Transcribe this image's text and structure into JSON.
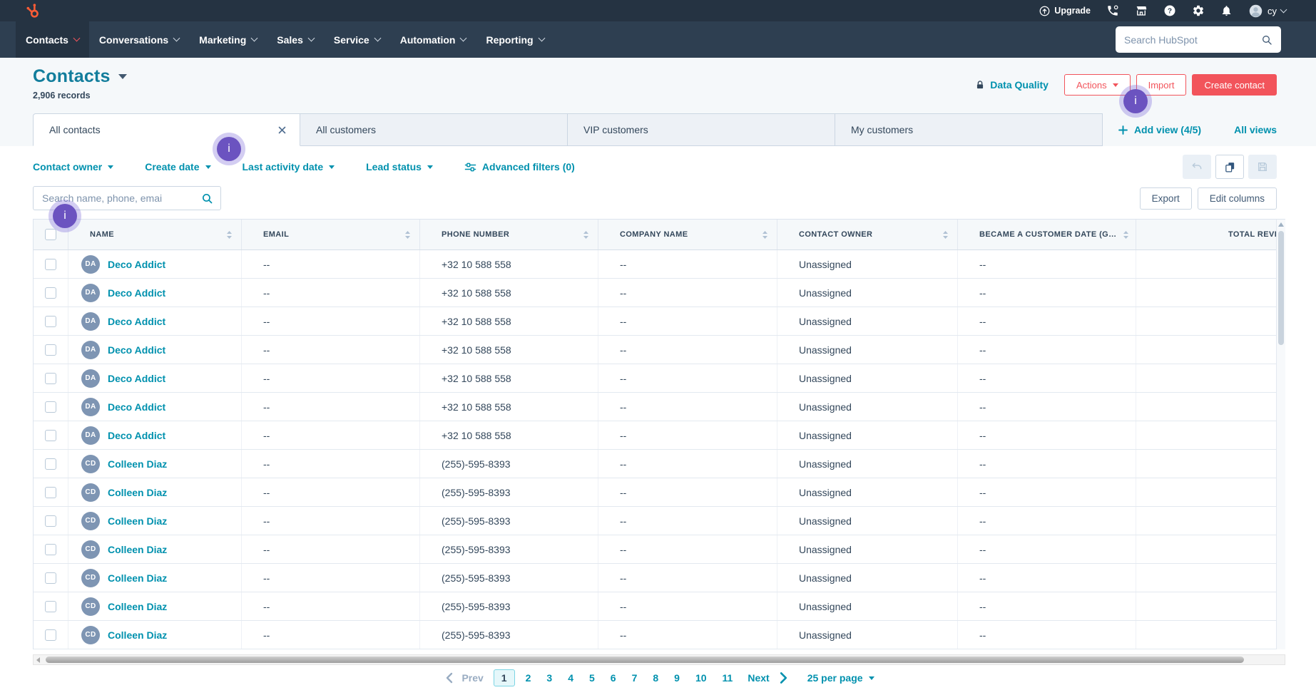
{
  "nav": {
    "items": [
      "Contacts",
      "Conversations",
      "Marketing",
      "Sales",
      "Service",
      "Automation",
      "Reporting"
    ],
    "active_item": "Contacts",
    "upgrade_label": "Upgrade",
    "user_name": "cy",
    "search_placeholder": "Search HubSpot"
  },
  "header": {
    "title": "Contacts",
    "records": "2,906 records",
    "data_quality_label": "Data Quality",
    "actions_label": "Actions",
    "import_label": "Import",
    "create_contact_label": "Create contact"
  },
  "tabs": {
    "items": [
      "All contacts",
      "All customers",
      "VIP customers",
      "My customers"
    ],
    "active_tab": "All contacts",
    "add_view_label": "Add view (4/5)",
    "all_views_label": "All views"
  },
  "filters": {
    "items": [
      "Contact owner",
      "Create date",
      "Last activity date",
      "Lead status"
    ],
    "advanced_label": "Advanced filters (0)"
  },
  "toolbar": {
    "search_placeholder": "Search name, phone, emai",
    "export_label": "Export",
    "edit_columns_label": "Edit columns"
  },
  "table": {
    "columns": [
      "NAME",
      "EMAIL",
      "PHONE NUMBER",
      "COMPANY NAME",
      "CONTACT OWNER",
      "BECAME A CUSTOMER DATE (G…",
      "TOTAL REVE"
    ],
    "rows": [
      {
        "initials": "DA",
        "name": "Deco Addict",
        "email": "--",
        "phone": "+32 10 588 558",
        "company": "--",
        "owner": "Unassigned",
        "became": "--",
        "total": ""
      },
      {
        "initials": "DA",
        "name": "Deco Addict",
        "email": "--",
        "phone": "+32 10 588 558",
        "company": "--",
        "owner": "Unassigned",
        "became": "--",
        "total": ""
      },
      {
        "initials": "DA",
        "name": "Deco Addict",
        "email": "--",
        "phone": "+32 10 588 558",
        "company": "--",
        "owner": "Unassigned",
        "became": "--",
        "total": ""
      },
      {
        "initials": "DA",
        "name": "Deco Addict",
        "email": "--",
        "phone": "+32 10 588 558",
        "company": "--",
        "owner": "Unassigned",
        "became": "--",
        "total": ""
      },
      {
        "initials": "DA",
        "name": "Deco Addict",
        "email": "--",
        "phone": "+32 10 588 558",
        "company": "--",
        "owner": "Unassigned",
        "became": "--",
        "total": ""
      },
      {
        "initials": "DA",
        "name": "Deco Addict",
        "email": "--",
        "phone": "+32 10 588 558",
        "company": "--",
        "owner": "Unassigned",
        "became": "--",
        "total": ""
      },
      {
        "initials": "DA",
        "name": "Deco Addict",
        "email": "--",
        "phone": "+32 10 588 558",
        "company": "--",
        "owner": "Unassigned",
        "became": "--",
        "total": ""
      },
      {
        "initials": "CD",
        "name": "Colleen Diaz",
        "email": "--",
        "phone": "(255)-595-8393",
        "company": "--",
        "owner": "Unassigned",
        "became": "--",
        "total": ""
      },
      {
        "initials": "CD",
        "name": "Colleen Diaz",
        "email": "--",
        "phone": "(255)-595-8393",
        "company": "--",
        "owner": "Unassigned",
        "became": "--",
        "total": ""
      },
      {
        "initials": "CD",
        "name": "Colleen Diaz",
        "email": "--",
        "phone": "(255)-595-8393",
        "company": "--",
        "owner": "Unassigned",
        "became": "--",
        "total": ""
      },
      {
        "initials": "CD",
        "name": "Colleen Diaz",
        "email": "--",
        "phone": "(255)-595-8393",
        "company": "--",
        "owner": "Unassigned",
        "became": "--",
        "total": ""
      },
      {
        "initials": "CD",
        "name": "Colleen Diaz",
        "email": "--",
        "phone": "(255)-595-8393",
        "company": "--",
        "owner": "Unassigned",
        "became": "--",
        "total": ""
      },
      {
        "initials": "CD",
        "name": "Colleen Diaz",
        "email": "--",
        "phone": "(255)-595-8393",
        "company": "--",
        "owner": "Unassigned",
        "became": "--",
        "total": ""
      },
      {
        "initials": "CD",
        "name": "Colleen Diaz",
        "email": "--",
        "phone": "(255)-595-8393",
        "company": "--",
        "owner": "Unassigned",
        "became": "--",
        "total": ""
      }
    ]
  },
  "pagination": {
    "prev_label": "Prev",
    "pages": [
      "1",
      "2",
      "3",
      "4",
      "5",
      "6",
      "7",
      "8",
      "9",
      "10",
      "11"
    ],
    "current": "1",
    "next_label": "Next",
    "per_page_label": "25 per page"
  },
  "markers": {
    "label": "i"
  },
  "icons": {
    "logo": "hubspot-sprocket",
    "upgrade": "circle-arrow-up",
    "phone": "phone-handset",
    "marketplace": "storefront",
    "help": "question-circle",
    "settings": "gear",
    "notifications": "bell",
    "user": "person-circle",
    "search": "magnifier",
    "lock": "padlock",
    "advanced_filters": "sliders",
    "undo": "curved-arrow-left",
    "copy": "overlapping-squares",
    "save": "floppy-disk",
    "close": "x-cross",
    "caret": "triangle-down",
    "sort": "triangles-up-down",
    "prev": "chevron-left",
    "next": "chevron-right",
    "add": "plus",
    "info_marker": "i"
  },
  "colors": {
    "accent": "#f2545b",
    "brand_orange": "#ff5c35",
    "link": "#0091ae",
    "navy": "#33475b",
    "nav_bg": "#2e3f51",
    "nav_top_bg": "#253342",
    "page_bg": "#f5f8fa",
    "avatar_bg": "#7e95b3",
    "marker_purple": "#6b53c0"
  }
}
